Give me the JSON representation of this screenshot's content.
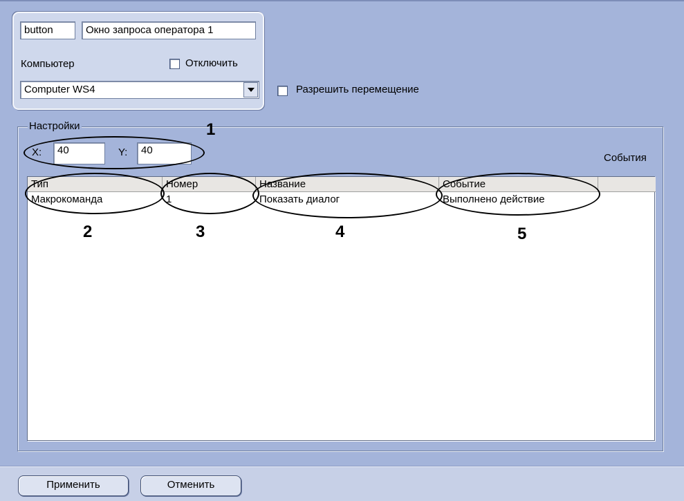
{
  "header": {
    "type_field": "button",
    "name_field": "Окно запроса оператора 1",
    "computer_label": "Компьютер",
    "disable_label": "Отключить",
    "computer_value": "Computer WS4",
    "allow_move_label": "Разрешить перемещение"
  },
  "settings": {
    "legend": "Настройки",
    "x_label": "X:",
    "x_value": "40",
    "y_label": "Y:",
    "y_value": "40",
    "events_label": "События"
  },
  "table": {
    "columns": [
      "Тип",
      "Номер",
      "Название",
      "Событие"
    ],
    "rows": [
      [
        "Макрокоманда",
        "1",
        "Показать диалог",
        "Выполнено действие"
      ]
    ]
  },
  "callouts": [
    "1",
    "2",
    "3",
    "4",
    "5"
  ],
  "footer": {
    "apply_label": "Применить",
    "cancel_label": "Отменить"
  }
}
